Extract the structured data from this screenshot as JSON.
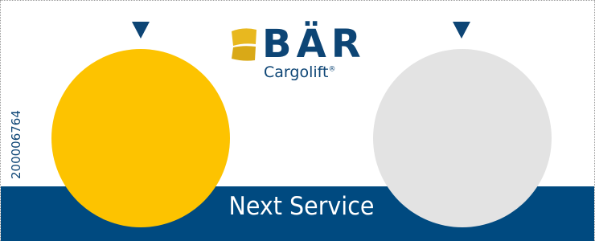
{
  "brand": {
    "name": "BÄR",
    "subname": "Cargolift",
    "registered_mark": "®",
    "logo_mark_color": "#e8b81f",
    "text_color": "#0d4575"
  },
  "label": {
    "part_number": "200006764",
    "band_text": "Next Service",
    "band_color": "#004a80"
  },
  "discs": [
    {
      "color": "#fdc300"
    },
    {
      "color": "#e3e3e3"
    }
  ]
}
